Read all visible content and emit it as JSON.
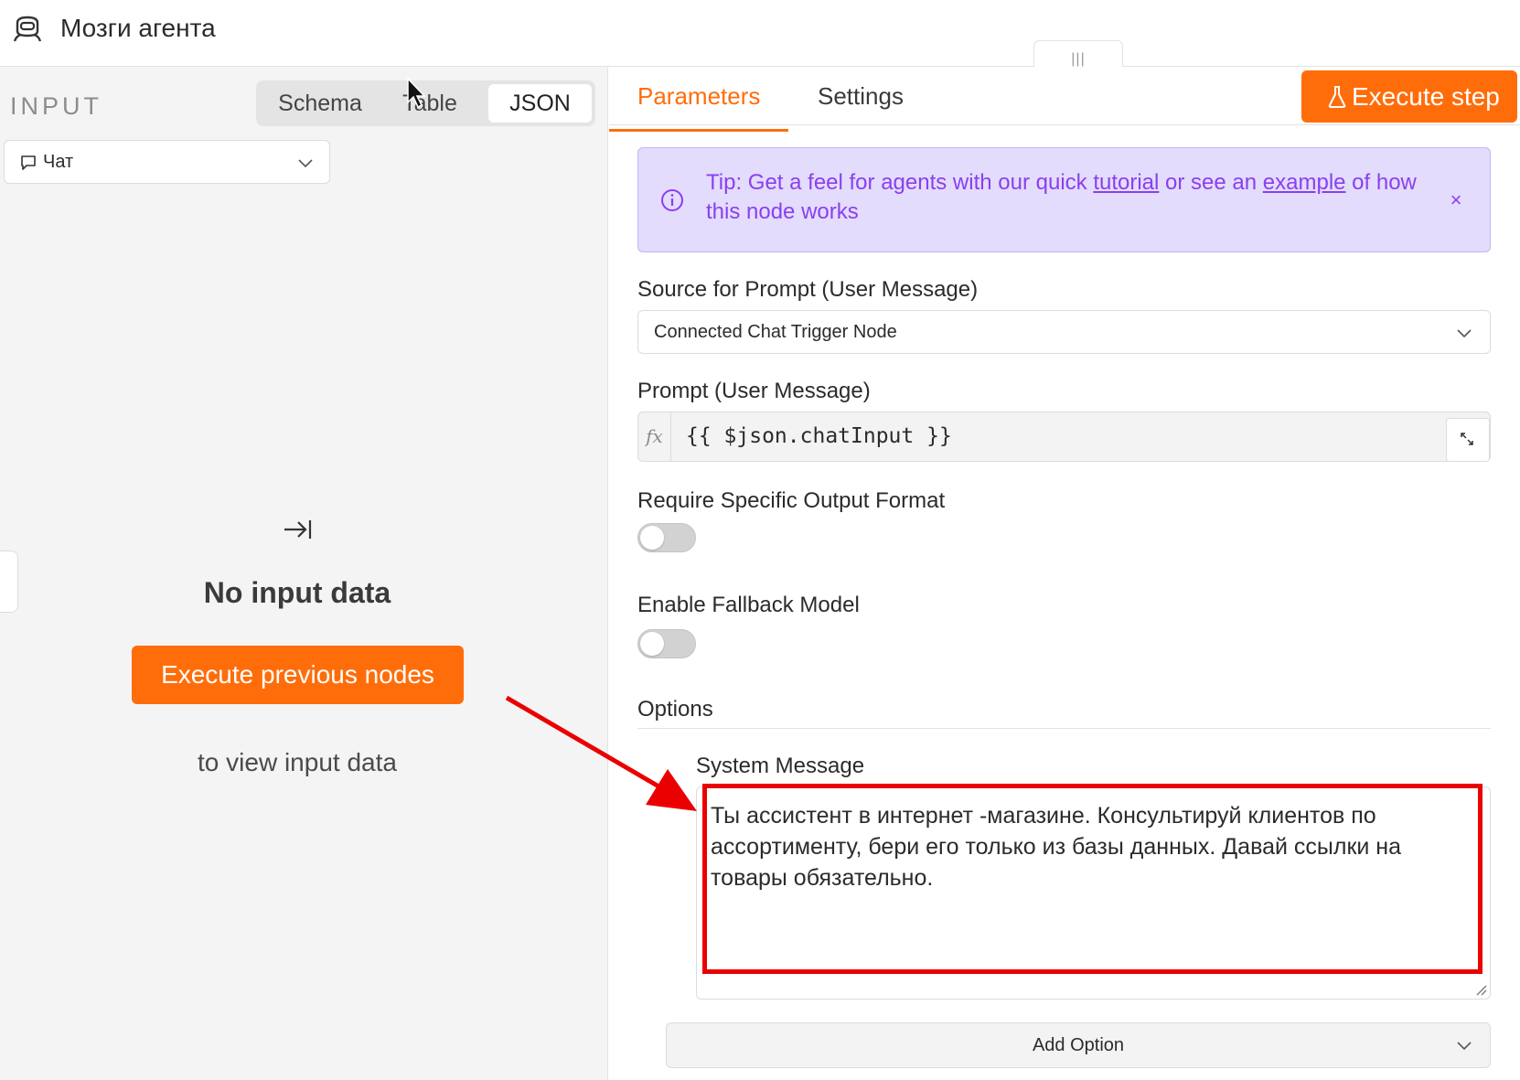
{
  "header": {
    "title": "Мозги агента",
    "icon": "robot-icon",
    "drag_handle": "|||"
  },
  "input_panel": {
    "heading": "INPUT",
    "views": [
      "Schema",
      "Table",
      "JSON"
    ],
    "selected_view": "JSON",
    "source_select": {
      "value": "Чат",
      "icon": "chat-bubble-icon"
    },
    "empty_state": {
      "title": "No input data",
      "button": "Execute previous nodes",
      "subtitle": "to view input data"
    }
  },
  "main": {
    "tabs": [
      {
        "label": "Parameters",
        "active": true
      },
      {
        "label": "Settings",
        "active": false
      }
    ],
    "execute_button": "Execute step",
    "tip": {
      "prefix": "Tip: Get a feel for agents with our quick ",
      "link1": "tutorial",
      "middle": " or see an ",
      "link2": "example",
      "suffix": " of how this node works",
      "close": "×"
    },
    "source_prompt": {
      "label": "Source for Prompt (User Message)",
      "value": "Connected Chat Trigger Node"
    },
    "prompt": {
      "label": "Prompt (User Message)",
      "fx": "fx",
      "value": "{{ $json.chatInput }}"
    },
    "require_output_format": {
      "label": "Require Specific Output Format",
      "enabled": false
    },
    "fallback_model": {
      "label": "Enable Fallback Model",
      "enabled": false
    },
    "options": {
      "label": "Options",
      "system_message": {
        "label": "System Message",
        "value": "Ты ассистент в интернет -магазине. Консультируй клиентов по ассортименту, бери его только из базы данных. Давай ссылки на товары обязательно."
      },
      "add_option": "Add Option"
    }
  },
  "colors": {
    "accent": "#ff6d0a",
    "tip_text": "#8a3ff0",
    "tip_bg": "#e3dcfc",
    "annotation_red": "#ea0000"
  }
}
